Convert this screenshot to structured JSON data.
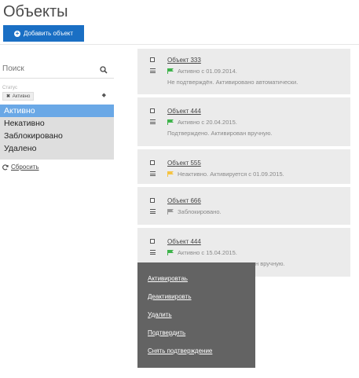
{
  "header": {
    "title": "Объекты",
    "add_button": "Добавить объект"
  },
  "filters": {
    "search_placeholder": "Поиск",
    "status_label": "Статус",
    "status_chip": "Активно",
    "status_options": [
      "Активно",
      "Некативно",
      "Заблокировано",
      "Удалено"
    ],
    "reset": "Сбросить"
  },
  "objects": [
    {
      "name": "Объект 333",
      "flag": "green",
      "status": "Активно с 01.09.2014.",
      "note": "Не подтверждён. Активировано автоматически."
    },
    {
      "name": "Объект 444",
      "flag": "green",
      "status": "Активно с 20.04.2015.",
      "note": "Подтверждено. Активирован вручную."
    },
    {
      "name": "Объект 555",
      "flag": "yellow",
      "status": "Неактивно. Активируется с 01.09.2015.",
      "note": ""
    },
    {
      "name": "Объект 666",
      "flag": "gray",
      "status": "Заблокировано.",
      "note": ""
    },
    {
      "name": "Объект 444",
      "flag": "green",
      "status": "Активно с 15.04.2015.",
      "note": "н вручную."
    }
  ],
  "context_menu": [
    "Активировтаь",
    "Деактивировть",
    "Удалить",
    "Подтвердить",
    "Снять подтверждение"
  ],
  "colors": {
    "primary": "#1a6fc4",
    "selected": "#6aa8e6",
    "flag_green": "#3db34a",
    "flag_yellow": "#f5c342",
    "flag_gray": "#999999"
  }
}
